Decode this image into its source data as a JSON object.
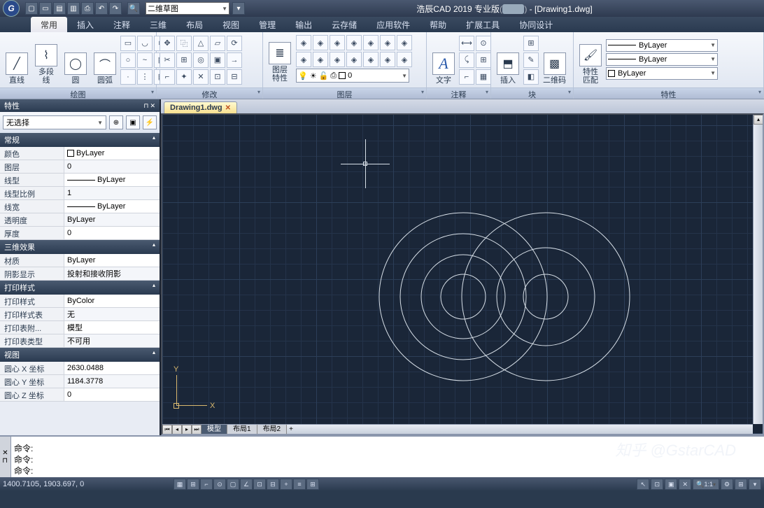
{
  "title": {
    "app": "浩辰CAD 2019 专业版",
    "doc": " - [Drawing1.dwg]"
  },
  "workspace": "二维草图",
  "tabs": [
    "常用",
    "插入",
    "注释",
    "三维",
    "布局",
    "视图",
    "管理",
    "输出",
    "云存储",
    "应用软件",
    "帮助",
    "扩展工具",
    "协同设计"
  ],
  "panels": {
    "draw": {
      "title": "绘图",
      "big": [
        "直线",
        "多段线",
        "圆",
        "圆弧"
      ]
    },
    "modify": {
      "title": "修改"
    },
    "layer": {
      "title": "图层",
      "big": "图层\n特性",
      "combo": "0"
    },
    "annotate": {
      "title": "注释",
      "big": "文字"
    },
    "block": {
      "title": "块",
      "big1": "插入",
      "big2": "二维码"
    },
    "props": {
      "title": "特性",
      "big": "特性\n匹配",
      "c1": "ByLayer",
      "c2": "ByLayer",
      "c3": "ByLayer"
    }
  },
  "propsPanel": {
    "title": "特性",
    "selection": "无选择",
    "groups": [
      {
        "name": "常规",
        "rows": [
          {
            "k": "颜色",
            "v": "ByLayer",
            "swatch": true
          },
          {
            "k": "图层",
            "v": "0"
          },
          {
            "k": "线型",
            "v": "ByLayer",
            "line": true
          },
          {
            "k": "线型比例",
            "v": "1"
          },
          {
            "k": "线宽",
            "v": "ByLayer",
            "line": true
          },
          {
            "k": "透明度",
            "v": "ByLayer"
          },
          {
            "k": "厚度",
            "v": "0"
          }
        ]
      },
      {
        "name": "三维效果",
        "rows": [
          {
            "k": "材质",
            "v": "ByLayer"
          },
          {
            "k": "阴影显示",
            "v": "投射和接收阴影"
          }
        ]
      },
      {
        "name": "打印样式",
        "rows": [
          {
            "k": "打印样式",
            "v": "ByColor"
          },
          {
            "k": "打印样式表",
            "v": "无"
          },
          {
            "k": "打印表附...",
            "v": "模型"
          },
          {
            "k": "打印表类型",
            "v": "不可用"
          }
        ]
      },
      {
        "name": "视图",
        "rows": [
          {
            "k": "圆心 X 坐标",
            "v": "2630.0488"
          },
          {
            "k": "圆心 Y 坐标",
            "v": "1184.3778"
          },
          {
            "k": "圆心 Z 坐标",
            "v": "0"
          }
        ]
      }
    ]
  },
  "docTab": "Drawing1.dwg",
  "layoutTabs": [
    "模型",
    "布局1",
    "布局2"
  ],
  "cmd": {
    "prompt": "命令:"
  },
  "status": {
    "coords": "1400.7105, 1903.697, 0",
    "scale": "1:1"
  },
  "watermark": "知乎 @GstarCAD"
}
